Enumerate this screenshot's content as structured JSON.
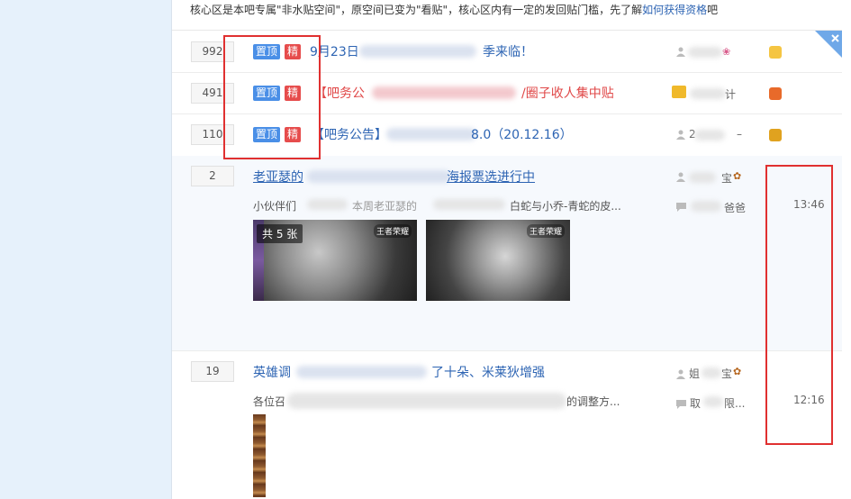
{
  "notice": {
    "text": "核心区是本吧专属\"非水贴空间\"，原空间已变为\"看贴\"，核心区内有一定的发回贴门槛，先了解",
    "link": "如何获得资格",
    "suffix": "吧"
  },
  "badges": {
    "top": "置顶",
    "good": "精"
  },
  "threads": [
    {
      "replies": "992",
      "title_start": "9月23日",
      "title_end": "季来临！",
      "author_start": ""
    },
    {
      "replies": "491",
      "title_start": "【吧务公",
      "title_end": "/圈子收人集中贴",
      "author_end": "计"
    },
    {
      "replies": "110",
      "title_start": "【吧务公告】",
      "title_end": "8.0（20.12.16）",
      "author_start": "2",
      "author_end": "–"
    },
    {
      "replies": "2",
      "title_start": "老亚瑟的",
      "title_end": "海报票选进行中",
      "excerpt_start": "小伙伴们",
      "excerpt_mid": "本周老亚瑟的",
      "excerpt_end": "白蛇与小乔-青蛇的皮...",
      "author_end": "宝",
      "last_reply_end": "爸爸",
      "time": "13:46",
      "image_count": "共 5 张",
      "image_logo": "王者荣耀"
    },
    {
      "replies": "19",
      "title_start": "英雄调",
      "title_end": "了十朵、米莱狄增强",
      "excerpt_start": "各位召",
      "excerpt_end": "的调整方...",
      "author_start": "姐",
      "author_end": "宝",
      "last_reply_start": "取",
      "last_reply_end": "限...",
      "time": "12:16"
    }
  ],
  "colors": {
    "accent_blue": "#2d64b3",
    "badge_top": "#4a8fe7",
    "badge_good": "#e64c4c",
    "highlight_red": "#e03030",
    "page_bg": "#e6f1fb"
  }
}
